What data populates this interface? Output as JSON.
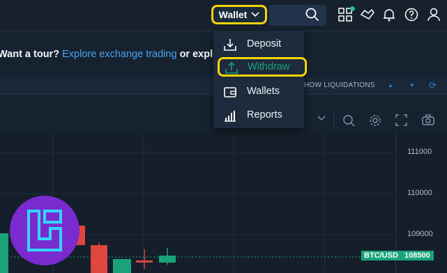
{
  "header": {
    "wallet_label": "Wallet"
  },
  "tour": {
    "prefix": "Want a tour?",
    "link": "Explore exchange trading",
    "suffix": "or explo"
  },
  "liquidations": {
    "label": "HOW LIQUIDATIONS"
  },
  "wallet_menu": {
    "items": [
      {
        "label": "Deposit",
        "icon": "deposit-icon"
      },
      {
        "label": "Withdraw",
        "icon": "withdraw-icon"
      },
      {
        "label": "Wallets",
        "icon": "wallet-icon"
      },
      {
        "label": "Reports",
        "icon": "reports-icon"
      }
    ]
  },
  "chart_axis": {
    "ticks": [
      "111000",
      "110000",
      "109000"
    ]
  },
  "price": {
    "symbol": "BTC/USD",
    "value": "108500"
  },
  "colors": {
    "highlight": "#f6d40a",
    "link": "#4ba3f2",
    "up": "#1aa37a",
    "down": "#e0453f",
    "logo": "#7a2bd0"
  }
}
